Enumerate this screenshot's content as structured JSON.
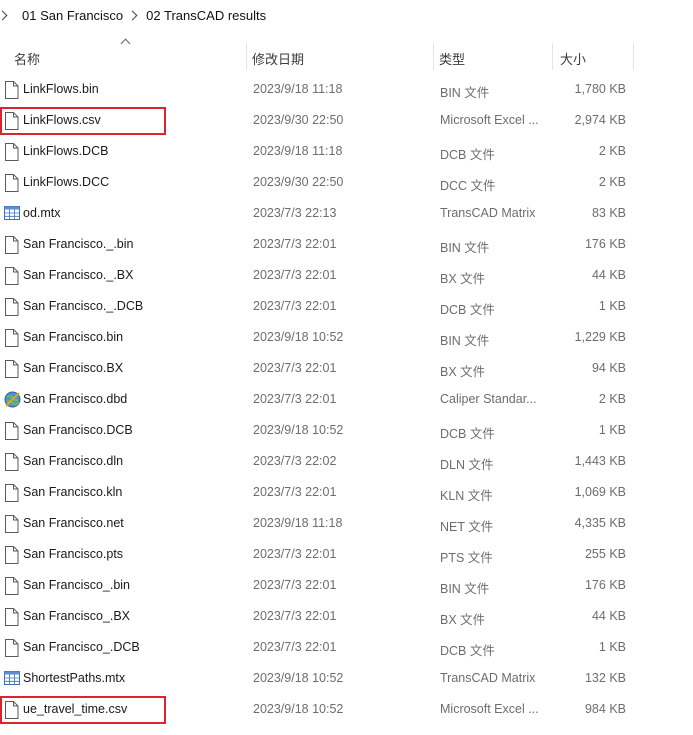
{
  "breadcrumb": {
    "items": [
      "01 San Francisco",
      "02 TransCAD results"
    ]
  },
  "columns": {
    "name": "名称",
    "date": "修改日期",
    "type": "类型",
    "size": "大小"
  },
  "files": [
    {
      "name": "LinkFlows.bin",
      "date": "2023/9/18 11:18",
      "type": "BIN 文件",
      "size": "1,780 KB",
      "icon": "file-icon"
    },
    {
      "name": "LinkFlows.csv",
      "date": "2023/9/30 22:50",
      "type": "Microsoft Excel ...",
      "size": "2,974 KB",
      "icon": "file-icon",
      "highlighted": true
    },
    {
      "name": "LinkFlows.DCB",
      "date": "2023/9/18 11:18",
      "type": "DCB 文件",
      "size": "2 KB",
      "icon": "file-icon"
    },
    {
      "name": "LinkFlows.DCC",
      "date": "2023/9/30 22:50",
      "type": "DCC 文件",
      "size": "2 KB",
      "icon": "file-icon"
    },
    {
      "name": "od.mtx",
      "date": "2023/7/3 22:13",
      "type": "TransCAD Matrix",
      "size": "83 KB",
      "icon": "matrix-icon"
    },
    {
      "name": "San Francisco._.bin",
      "date": "2023/7/3 22:01",
      "type": "BIN 文件",
      "size": "176 KB",
      "icon": "file-icon"
    },
    {
      "name": "San Francisco._.BX",
      "date": "2023/7/3 22:01",
      "type": "BX 文件",
      "size": "44 KB",
      "icon": "file-icon"
    },
    {
      "name": "San Francisco._.DCB",
      "date": "2023/7/3 22:01",
      "type": "DCB 文件",
      "size": "1 KB",
      "icon": "file-icon"
    },
    {
      "name": "San Francisco.bin",
      "date": "2023/9/18 10:52",
      "type": "BIN 文件",
      "size": "1,229 KB",
      "icon": "file-icon"
    },
    {
      "name": "San Francisco.BX",
      "date": "2023/7/3 22:01",
      "type": "BX 文件",
      "size": "94 KB",
      "icon": "file-icon"
    },
    {
      "name": "San Francisco.dbd",
      "date": "2023/7/3 22:01",
      "type": "Caliper Standar...",
      "size": "2 KB",
      "icon": "globe-icon"
    },
    {
      "name": "San Francisco.DCB",
      "date": "2023/9/18 10:52",
      "type": "DCB 文件",
      "size": "1 KB",
      "icon": "file-icon"
    },
    {
      "name": "San Francisco.dln",
      "date": "2023/7/3 22:02",
      "type": "DLN 文件",
      "size": "1,443 KB",
      "icon": "file-icon"
    },
    {
      "name": "San Francisco.kln",
      "date": "2023/7/3 22:01",
      "type": "KLN 文件",
      "size": "1,069 KB",
      "icon": "file-icon"
    },
    {
      "name": "San Francisco.net",
      "date": "2023/9/18 11:18",
      "type": "NET 文件",
      "size": "4,335 KB",
      "icon": "file-icon"
    },
    {
      "name": "San Francisco.pts",
      "date": "2023/7/3 22:01",
      "type": "PTS 文件",
      "size": "255 KB",
      "icon": "file-icon"
    },
    {
      "name": "San Francisco_.bin",
      "date": "2023/7/3 22:01",
      "type": "BIN 文件",
      "size": "176 KB",
      "icon": "file-icon"
    },
    {
      "name": "San Francisco_.BX",
      "date": "2023/7/3 22:01",
      "type": "BX 文件",
      "size": "44 KB",
      "icon": "file-icon"
    },
    {
      "name": "San Francisco_.DCB",
      "date": "2023/7/3 22:01",
      "type": "DCB 文件",
      "size": "1 KB",
      "icon": "file-icon"
    },
    {
      "name": "ShortestPaths.mtx",
      "date": "2023/9/18 10:52",
      "type": "TransCAD Matrix",
      "size": "132 KB",
      "icon": "matrix-icon"
    },
    {
      "name": "ue_travel_time.csv",
      "date": "2023/9/18 10:52",
      "type": "Microsoft Excel ...",
      "size": "984 KB",
      "icon": "file-icon",
      "highlighted": true
    }
  ],
  "colors": {
    "highlight": "#d9262e",
    "secondary_text": "#6d6d6d"
  }
}
